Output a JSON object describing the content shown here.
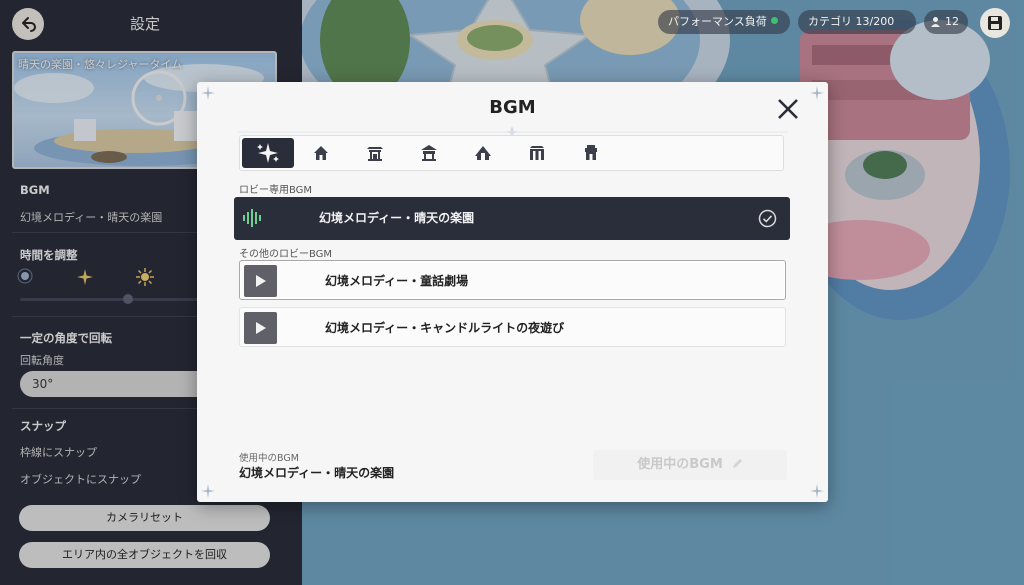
{
  "colors": {
    "panel_bg": "#272a35",
    "modal_bg": "#f6f6f6",
    "accent_dark": "#2a2d3a",
    "status_ok": "#3fbf6f",
    "wave_green": "#6fcf8f"
  },
  "side_panel": {
    "title": "設定",
    "preview_caption": "晴天の楽園・悠々レジャータイム",
    "bgm_section": "BGM",
    "bgm_current": "幻境メロディー・晴天の楽園",
    "time_section": "時間を調整",
    "rotate_section": "一定の角度で回転",
    "rotate_angle_label": "回転角度",
    "rotate_angle_value": "30°",
    "snap_section": "スナップ",
    "snap_frame": "枠線にスナップ",
    "snap_object": "オブジェクトにスナップ",
    "camera_reset": "カメラリセット",
    "collect_all": "エリア内の全オブジェクトを回収"
  },
  "status_bar": {
    "performance": "パフォーマンス負荷",
    "category": "カテゴリ 13/200",
    "users": "12"
  },
  "modal": {
    "title": "BGM",
    "lobby_only_label": "ロビー専用BGM",
    "other_label": "その他のロビーBGM",
    "current_track": "幻境メロディー・晴天の楽園",
    "tracks": [
      {
        "title": "幻境メロディー・童話劇場"
      },
      {
        "title": "幻境メロディー・キャンドルライトの夜遊び"
      }
    ],
    "using_caption": "使用中のBGM",
    "using_name": "幻境メロディー・晴天の楽園",
    "using_button": "使用中のBGM"
  },
  "icons": [
    "back-arrow-icon",
    "save-icon",
    "user-icon",
    "close-icon",
    "sparkle-icon",
    "house-icon",
    "shrine-icon",
    "pavilion-icon",
    "tent-icon",
    "gate-icon",
    "tower-icon",
    "sound-wave-icon",
    "check-icon",
    "play-icon",
    "pencil-icon",
    "sun-icon"
  ]
}
